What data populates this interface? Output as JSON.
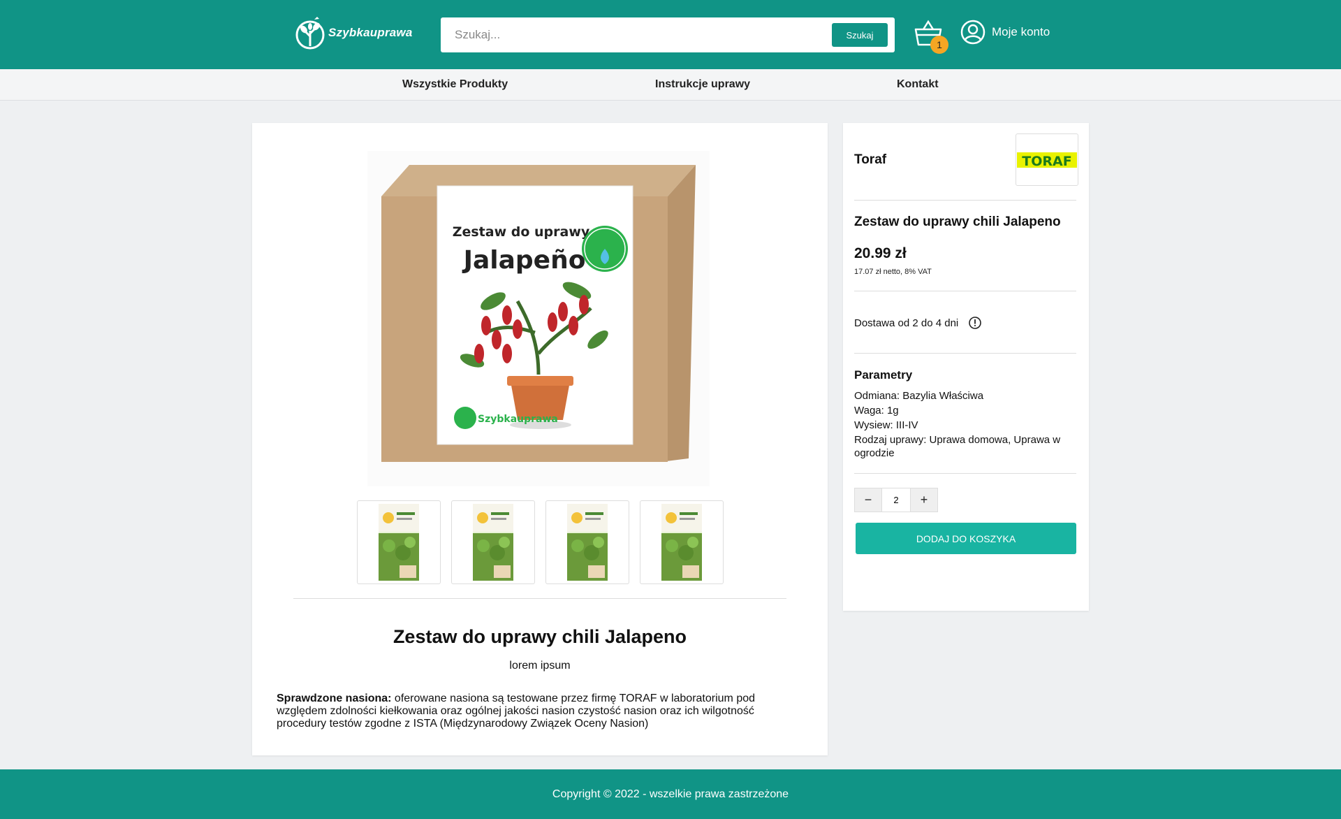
{
  "header": {
    "logo_text": "Szybkauprawa",
    "search_placeholder": "Szukaj...",
    "search_button": "Szukaj",
    "cart_count": "1",
    "account_label": "Moje konto"
  },
  "nav": {
    "items": [
      {
        "label": "Wszystkie Produkty"
      },
      {
        "label": "Instrukcje uprawy"
      },
      {
        "label": "Kontakt"
      }
    ]
  },
  "product": {
    "box_heading": "Zestaw do uprawy",
    "box_name": "Jalapeño",
    "box_badge": "Dodaj Trochę Wody",
    "box_brand": "Szybkauprawa",
    "title": "Zestaw do uprawy chili Jalapeno",
    "subtitle": "lorem ipsum",
    "desc_bold": "Sprawdzone nasiona:",
    "desc_text": " oferowane nasiona są testowane przez firmę TORAF w laboratorium pod względem zdolności kiełkowania oraz ogólnej jakości nasion czystość nasion oraz ich wilgotność procedury testów zgodne z ISTA (Międzynarodowy Związek Oceny Nasion)"
  },
  "side": {
    "brand_name": "Toraf",
    "brand_logo_text": "TORAF",
    "title": "Zestaw do uprawy chili Jalapeno",
    "price": "20.99 zł",
    "price_net": "17.07 zł netto, 8% VAT",
    "delivery": "Dostawa od 2 do 4 dni",
    "params_title": "Parametry",
    "params": [
      "Odmiana: Bazylia Właściwa",
      "Waga: 1g",
      "Wysiew: III-IV",
      "Rodzaj uprawy: Uprawa domowa, Uprawa w ogrodzie"
    ],
    "qty_minus": "−",
    "qty_value": "2",
    "qty_plus": "+",
    "add_to_cart": "DODAJ DO KOSZYKA"
  },
  "footer": {
    "copyright": "Copyright © 2022 - wszelkie prawa zastrzeżone"
  },
  "colors": {
    "primary": "#109486",
    "accent_button": "#19b4a2",
    "badge": "#f5a623"
  }
}
